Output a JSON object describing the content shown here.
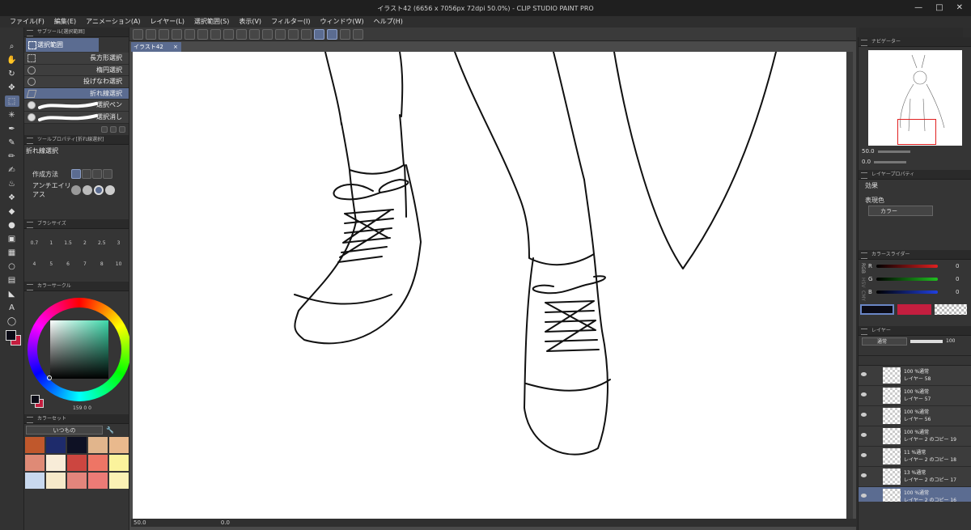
{
  "window": {
    "title": "イラスト42 (6656 x 7056px 72dpi 50.0%) - CLIP STUDIO PAINT PRO",
    "controls": [
      "—",
      "□",
      "✕"
    ]
  },
  "menu": [
    "ファイル(F)",
    "編集(E)",
    "アニメーション(A)",
    "レイヤー(L)",
    "選択範囲(S)",
    "表示(V)",
    "フィルター(I)",
    "ウィンドウ(W)",
    "ヘルプ(H)"
  ],
  "subtool": {
    "header": "サブツール[選択範囲]",
    "tab": "選択範囲",
    "items": [
      "長方形選択",
      "楕円選択",
      "投げなわ選択",
      "折れ線選択",
      "選択ペン",
      "選択消し"
    ],
    "selected_index": 3
  },
  "toolprop": {
    "header": "ツールプロパティ[折れ線選択]",
    "title": "折れ線選択",
    "row1_label": "作成方法",
    "row2_label": "アンチエイリアス"
  },
  "brushsize": {
    "header": "ブラシサイズ",
    "values": [
      "0.7",
      "1",
      "1.5",
      "2",
      "2.5",
      "3",
      "4",
      "5",
      "6",
      "7",
      "8",
      "10"
    ]
  },
  "colorwheel": {
    "header": "カラーサークル",
    "readout": "159  0  0"
  },
  "colorset": {
    "header": "カラーセット",
    "set_name": "いつもの",
    "colors": [
      "#c0582c",
      "#1e2b6b",
      "#0e1124",
      "#e1b58c",
      "#e9b98d",
      "#df8a76",
      "#f8ecd8",
      "#cc4640",
      "#ee7565",
      "#fbf39c",
      "#c8d8ee",
      "#f6e9c9",
      "#e3857c",
      "#ec7b76",
      "#fbf1b4"
    ]
  },
  "doc_tab": {
    "label": "イラスト42",
    "close": "×"
  },
  "status": {
    "zoom": "50.0",
    "angle": "0.0"
  },
  "navigator": {
    "tab": "ナビゲーター",
    "zoom": "50.0",
    "angle": "0.0"
  },
  "layerprop": {
    "tab": "レイヤープロパティ",
    "effect_label": "効果",
    "color_label": "表現色",
    "color_value": "カラー"
  },
  "colorslider": {
    "tab": "カラースライダー",
    "side_labels": [
      "RGB",
      "HSV",
      "CMY"
    ],
    "channels": [
      {
        "label": "R",
        "value": "0",
        "color": "#e02020"
      },
      {
        "label": "G",
        "value": "0",
        "color": "#20c020"
      },
      {
        "label": "B",
        "value": "0",
        "color": "#2040e0"
      }
    ],
    "main_color": "#0b0b16",
    "sub_color": "#c41e3f"
  },
  "layers": {
    "tab": "レイヤー",
    "blend_mode": "通常",
    "opacity": "100",
    "rows": [
      {
        "mode": "100 %通常",
        "name": "レイヤー 58"
      },
      {
        "mode": "100 %通常",
        "name": "レイヤー 57"
      },
      {
        "mode": "100 %通常",
        "name": "レイヤー 56"
      },
      {
        "mode": "100 %通常",
        "name": "レイヤー 2 のコピー 19"
      },
      {
        "mode": "11 %通常",
        "name": "レイヤー 2 のコピー 18"
      },
      {
        "mode": "13 %通常",
        "name": "レイヤー 2 のコピー 17"
      },
      {
        "mode": "100 %通常",
        "name": "レイヤー 2 のコピー 16"
      }
    ],
    "selected_index": 6
  },
  "colors": {
    "accent": "#5b6c91",
    "panel": "#353535",
    "canvas": "#ffffff"
  }
}
